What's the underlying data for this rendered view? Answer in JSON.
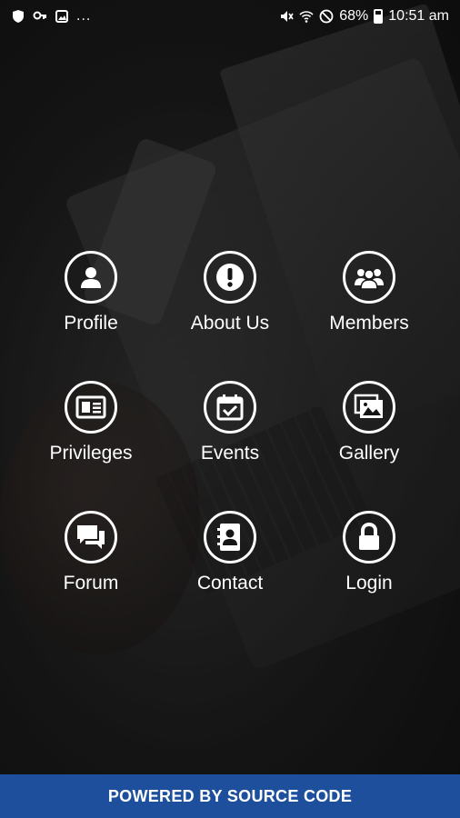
{
  "status_bar": {
    "left_icons": [
      "shield-icon",
      "key-icon",
      "image-icon"
    ],
    "more": "...",
    "battery": "68%",
    "time": "10:51 am",
    "right_icons": [
      "mute-icon",
      "wifi-icon",
      "block-icon",
      "battery-icon"
    ]
  },
  "menu": {
    "items": [
      {
        "label": "Profile",
        "icon": "person-icon"
      },
      {
        "label": "About Us",
        "icon": "info-icon"
      },
      {
        "label": "Members",
        "icon": "group-icon"
      },
      {
        "label": "Privileges",
        "icon": "id-card-icon"
      },
      {
        "label": "Events",
        "icon": "calendar-check-icon"
      },
      {
        "label": "Gallery",
        "icon": "gallery-icon"
      },
      {
        "label": "Forum",
        "icon": "chat-icon"
      },
      {
        "label": "Contact",
        "icon": "contact-book-icon"
      },
      {
        "label": "Login",
        "icon": "lock-icon"
      }
    ]
  },
  "footer": {
    "text": "POWERED BY SOURCE CODE"
  },
  "colors": {
    "footer_bg": "#1e4f9c",
    "icon": "#ffffff"
  }
}
